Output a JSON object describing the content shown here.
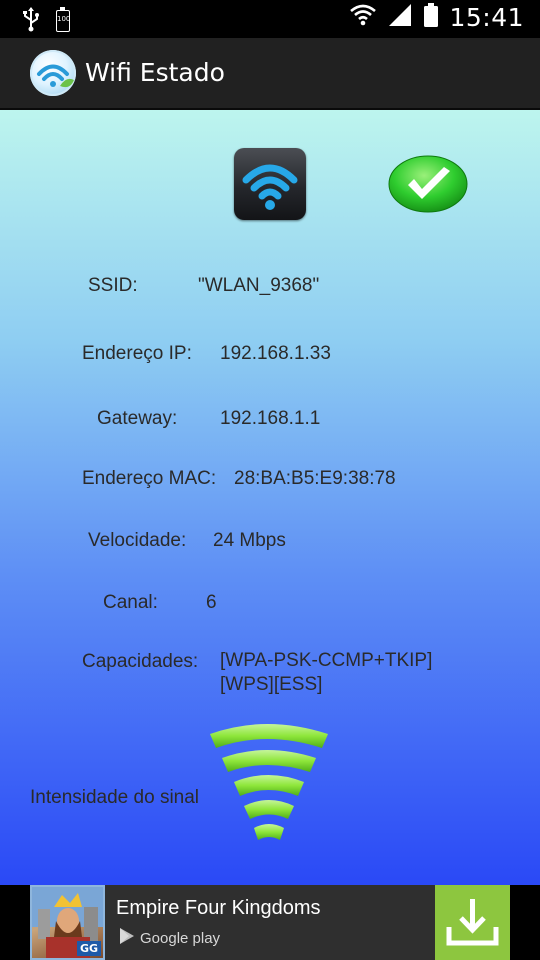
{
  "status_bar": {
    "time": "15:41",
    "battery_level": "100",
    "icons": [
      "usb-icon",
      "battery-icon",
      "wifi-icon",
      "cell-signal-icon",
      "battery-full-icon"
    ]
  },
  "app_bar": {
    "title": "Wifi Estado",
    "icon": "wifi-estado-app-icon"
  },
  "colors": {
    "status_bar_bg": "#000000",
    "app_bar_bg": "#212121",
    "gradient_top": "#bdf5ee",
    "gradient_bottom": "#2a49f6",
    "ok_green": "#2fcd2f",
    "wifi_blue": "#27a8e8",
    "signal_green": "#8ee63a",
    "ad_bg": "#2f2f2f",
    "ad_download_bg": "#8dc63f",
    "label_text": "#2a2a2a"
  },
  "status_icons": {
    "wifi_tile": "wifi-connected-icon",
    "check": "connected-check-icon"
  },
  "info": {
    "ssid_label": "SSID:",
    "ssid_value": "\"WLAN_9368\"",
    "ip_label": "Endereço IP:",
    "ip_value": "192.168.1.33",
    "gateway_label": "Gateway:",
    "gateway_value": "192.168.1.1",
    "mac_label": "Endereço MAC:",
    "mac_value": "28:BA:B5:E9:38:78",
    "speed_label": "Velocidade:",
    "speed_value": "24 Mbps",
    "channel_label": "Canal:",
    "channel_value": "6",
    "capabilities_label": "Capacidades:",
    "capabilities_value": "[WPA-PSK-CCMP+TKIP][WPS][ESS]"
  },
  "signal": {
    "label": "Intensidade do sinal",
    "icon": "signal-strength-icon",
    "bars_filled": 5,
    "bars_total": 5
  },
  "ad": {
    "title": "Empire Four Kingdoms",
    "store_label": "Google play",
    "thumb_badge": "GG",
    "download_icon": "download-icon"
  }
}
